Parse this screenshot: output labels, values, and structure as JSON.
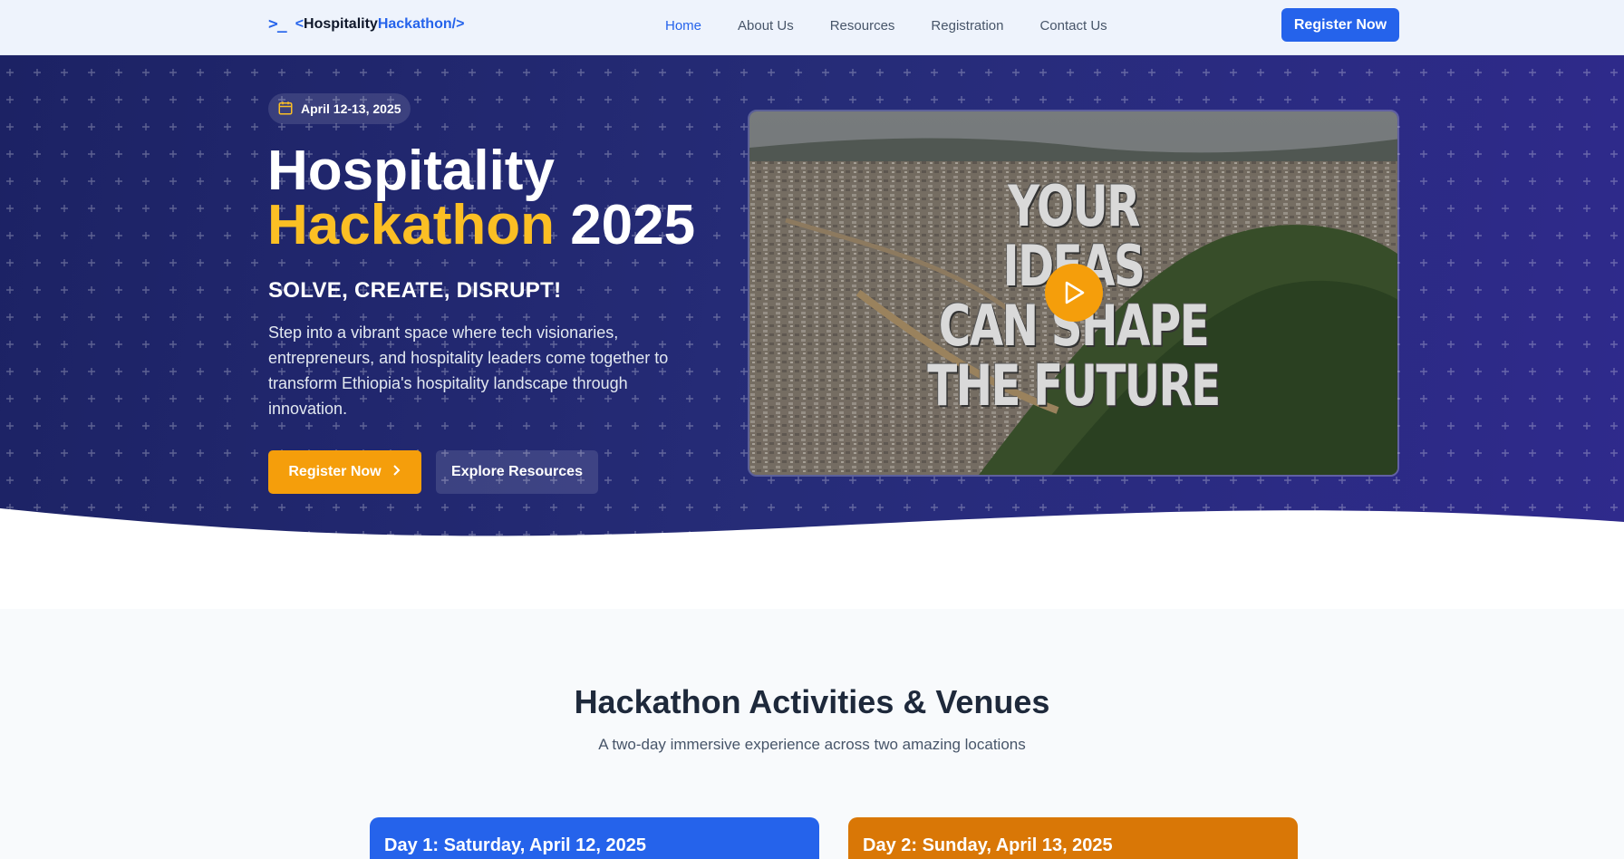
{
  "nav": {
    "logo_prefix": "<",
    "logo_name": "Hospitality",
    "logo_accent": "Hackathon",
    "logo_suffix": "/>",
    "logo_icon": "terminal-icon",
    "links": [
      "Home",
      "About Us",
      "Resources",
      "Registration",
      "Contact Us"
    ],
    "active": "Home",
    "cta": "Register Now"
  },
  "hero": {
    "date": "April 12-13, 2025",
    "title_line1": "Hospitality",
    "title_accent": "Hackathon",
    "title_year": "2025",
    "tagline": "SOLVE, CREATE, DISRUPT!",
    "description": "Step into a vibrant space where tech visionaries, entrepreneurs, and hospitality leaders come together to transform Ethiopia's hospitality landscape through innovation.",
    "primary_button": "Register Now",
    "secondary_button": "Explore Resources",
    "video_caption": [
      "YOUR",
      "IDEAS",
      "CAN SHAPE",
      "THE FUTURE"
    ]
  },
  "activities": {
    "title": "Hackathon Activities & Venues",
    "subtitle": "A two-day immersive experience across two amazing locations",
    "days": [
      "Day 1: Saturday, April 12, 2025",
      "Day 2: Sunday, April 13, 2025"
    ]
  },
  "colors": {
    "primary": "#2563eb",
    "accent": "#f59e0b",
    "hero_bg": "#232872",
    "day2": "#d97706"
  }
}
